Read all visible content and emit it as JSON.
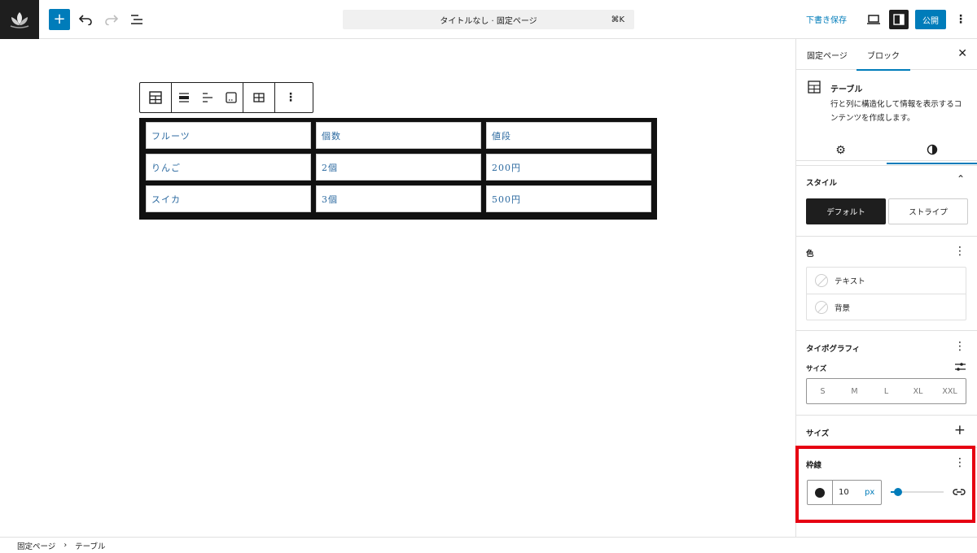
{
  "header": {
    "document_title": "タイトルなし · 固定ページ",
    "shortcut": "⌘K",
    "save_draft_label": "下書き保存",
    "publish_label": "公開"
  },
  "block_toolbar": {
    "icons": [
      "table-icon",
      "align-wide-icon",
      "align-left-icon",
      "caption-icon",
      "table-edit-icon",
      "more-icon"
    ]
  },
  "table": {
    "rows": [
      [
        "フルーツ",
        "個数",
        "値段"
      ],
      [
        "りんご",
        "2個",
        "200円"
      ],
      [
        "スイカ",
        "3個",
        "500円"
      ]
    ]
  },
  "sidebar": {
    "tabs": [
      "固定ページ",
      "ブロック"
    ],
    "active_tab": "ブロック",
    "block_name": "テーブル",
    "block_description": "行と列に構造化して情報を表示するコンテンツを作成します。",
    "style_panel": {
      "title": "スタイル",
      "options": [
        "デフォルト",
        "ストライプ"
      ],
      "selected": "デフォルト"
    },
    "color_panel": {
      "title": "色",
      "items": [
        "テキスト",
        "背景"
      ]
    },
    "typography_panel": {
      "title": "タイポグラフィ",
      "size_label": "サイズ",
      "sizes": [
        "S",
        "M",
        "L",
        "XL",
        "XXL"
      ]
    },
    "dimensions_panel": {
      "title": "サイズ"
    },
    "border_panel": {
      "title": "枠線",
      "width_value": "10",
      "unit": "px",
      "slider_fraction": 0.1
    }
  },
  "breadcrumb": [
    "固定ページ",
    "テーブル"
  ],
  "colors": {
    "accent": "#007cba",
    "highlight": "#e60012",
    "table_border": "#111111"
  }
}
